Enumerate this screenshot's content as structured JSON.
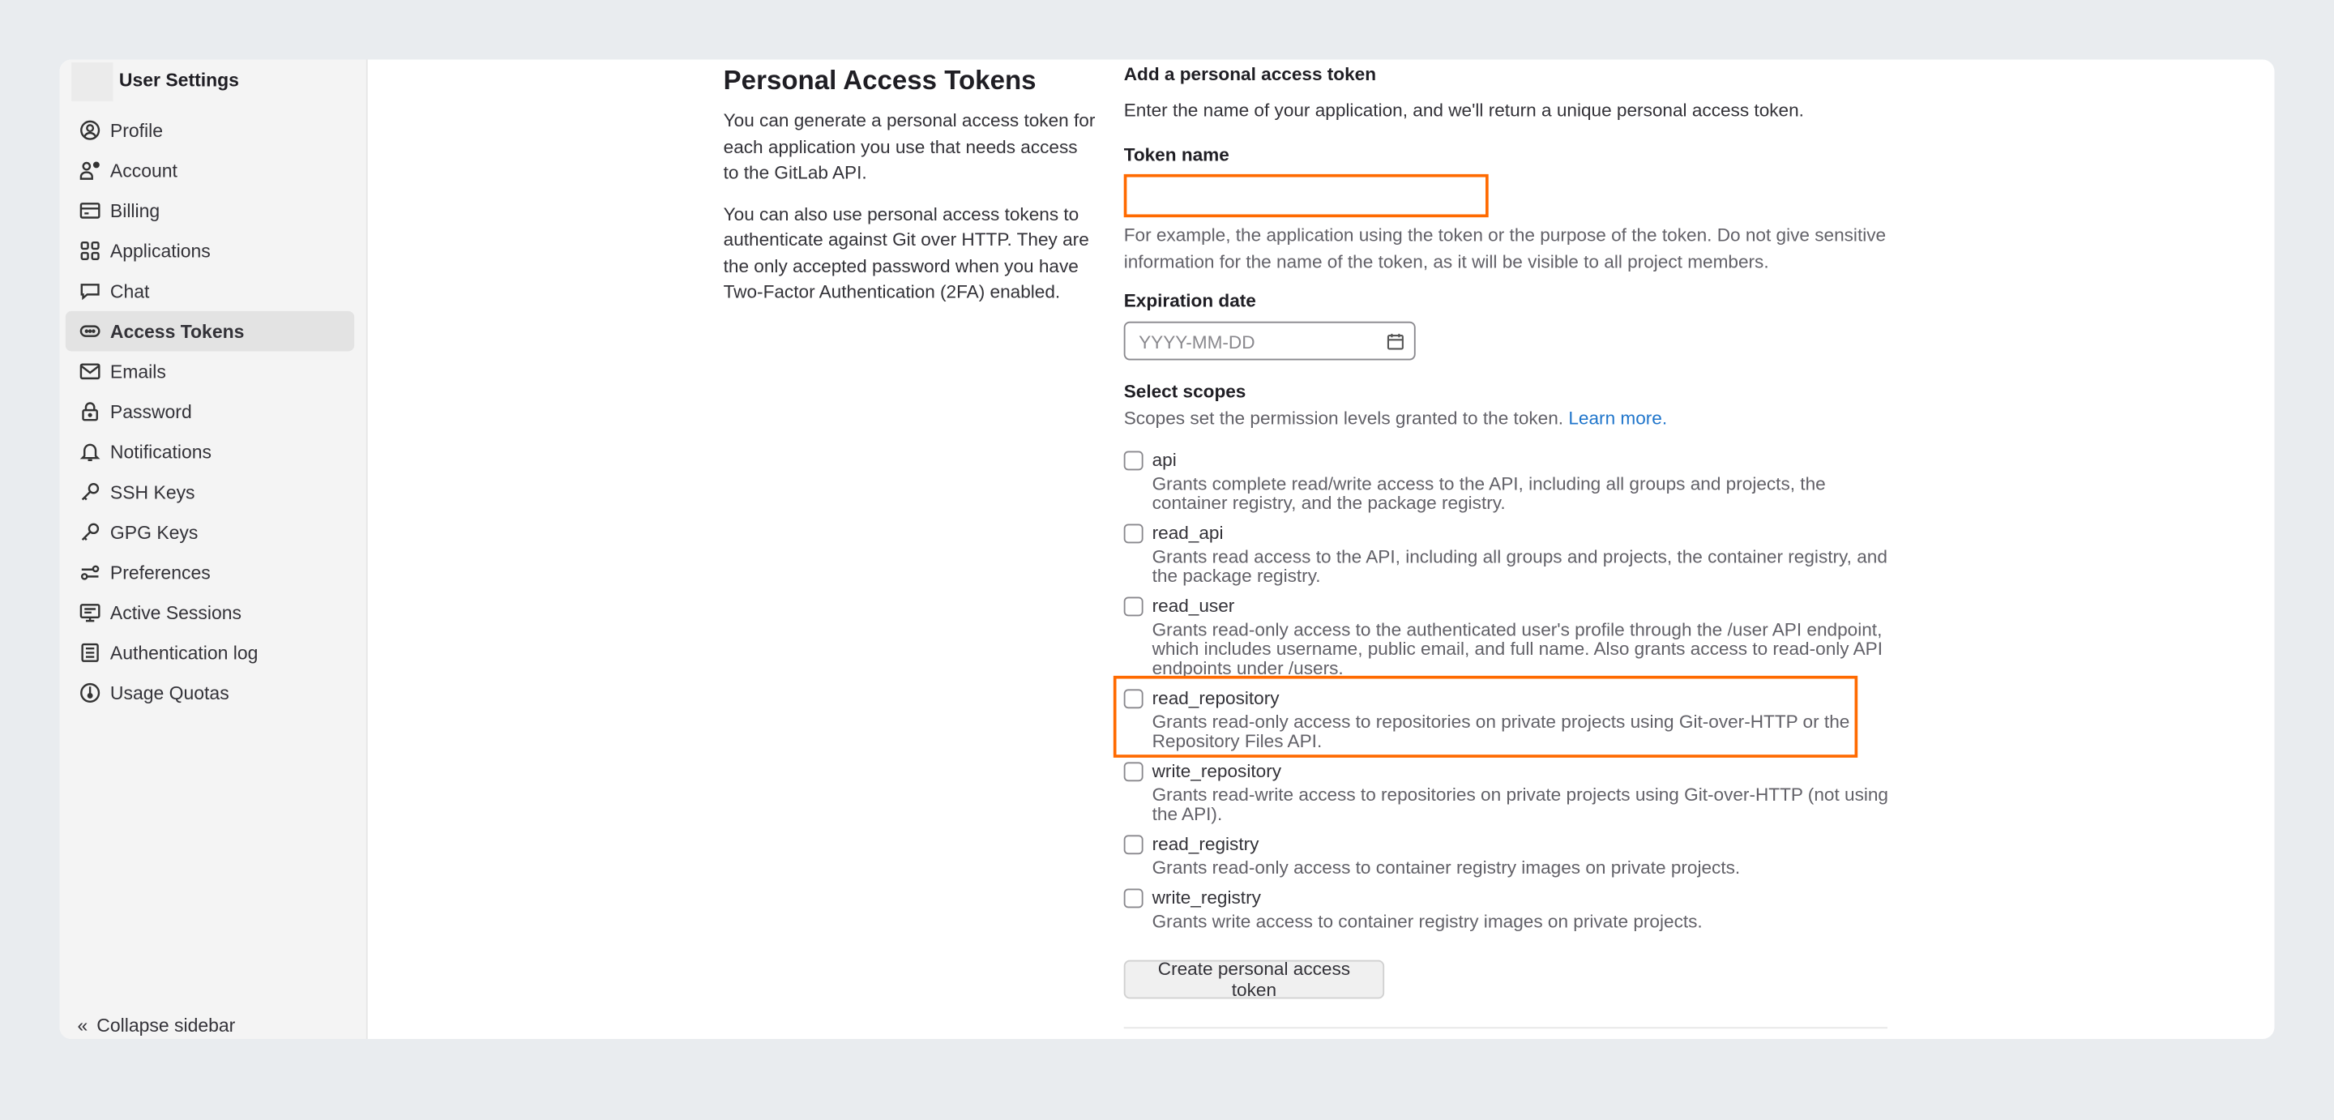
{
  "sidebar": {
    "title": "User Settings",
    "items": [
      {
        "label": "Profile",
        "icon": "profile-icon"
      },
      {
        "label": "Account",
        "icon": "account-icon"
      },
      {
        "label": "Billing",
        "icon": "billing-icon"
      },
      {
        "label": "Applications",
        "icon": "applications-icon"
      },
      {
        "label": "Chat",
        "icon": "chat-icon"
      },
      {
        "label": "Access Tokens",
        "icon": "token-icon",
        "active": true
      },
      {
        "label": "Emails",
        "icon": "mail-icon"
      },
      {
        "label": "Password",
        "icon": "lock-icon"
      },
      {
        "label": "Notifications",
        "icon": "bell-icon"
      },
      {
        "label": "SSH Keys",
        "icon": "key-icon"
      },
      {
        "label": "GPG Keys",
        "icon": "key-icon"
      },
      {
        "label": "Preferences",
        "icon": "preferences-icon"
      },
      {
        "label": "Active Sessions",
        "icon": "monitor-icon"
      },
      {
        "label": "Authentication log",
        "icon": "log-icon"
      },
      {
        "label": "Usage Quotas",
        "icon": "quota-icon"
      }
    ],
    "collapse_label": "Collapse sidebar"
  },
  "intro": {
    "title": "Personal Access Tokens",
    "para1": "You can generate a personal access token for each application you use that needs access to the GitLab API.",
    "para2": "You can also use personal access tokens to authenticate against Git over HTTP. They are the only accepted password when you have Two-Factor Authentication (2FA) enabled."
  },
  "form": {
    "heading": "Add a personal access token",
    "subheading": "Enter the name of your application, and we'll return a unique personal access token.",
    "token_name_label": "Token name",
    "token_name_value": "",
    "token_name_help": "For example, the application using the token or the purpose of the token. Do not give sensitive information for the name of the token, as it will be visible to all project members.",
    "expiration_label": "Expiration date",
    "expiration_placeholder": "YYYY-MM-DD",
    "scopes_label": "Select scopes",
    "scopes_help": "Scopes set the permission levels granted to the token.",
    "learn_more": "Learn more.",
    "scopes": [
      {
        "name": "api",
        "desc": "Grants complete read/write access to the API, including all groups and projects, the container registry, and the package registry.",
        "checked": false
      },
      {
        "name": "read_api",
        "desc": "Grants read access to the API, including all groups and projects, the container registry, and the package registry.",
        "checked": false
      },
      {
        "name": "read_user",
        "desc": "Grants read-only access to the authenticated user's profile through the /user API endpoint, which includes username, public email, and full name. Also grants access to read-only API endpoints under /users.",
        "checked": false
      },
      {
        "name": "read_repository",
        "desc": "Grants read-only access to repositories on private projects using Git-over-HTTP or the Repository Files API.",
        "checked": false
      },
      {
        "name": "write_repository",
        "desc": "Grants read-write access to repositories on private projects using Git-over-HTTP (not using the API).",
        "checked": false
      },
      {
        "name": "read_registry",
        "desc": "Grants read-only access to container registry images on private projects.",
        "checked": false
      },
      {
        "name": "write_registry",
        "desc": "Grants write access to container registry images on private projects.",
        "checked": false
      }
    ],
    "submit_label": "Create personal access token"
  },
  "colors": {
    "highlight": "#ff6a00",
    "link": "#1f75cb",
    "background": "#e9ecef"
  }
}
